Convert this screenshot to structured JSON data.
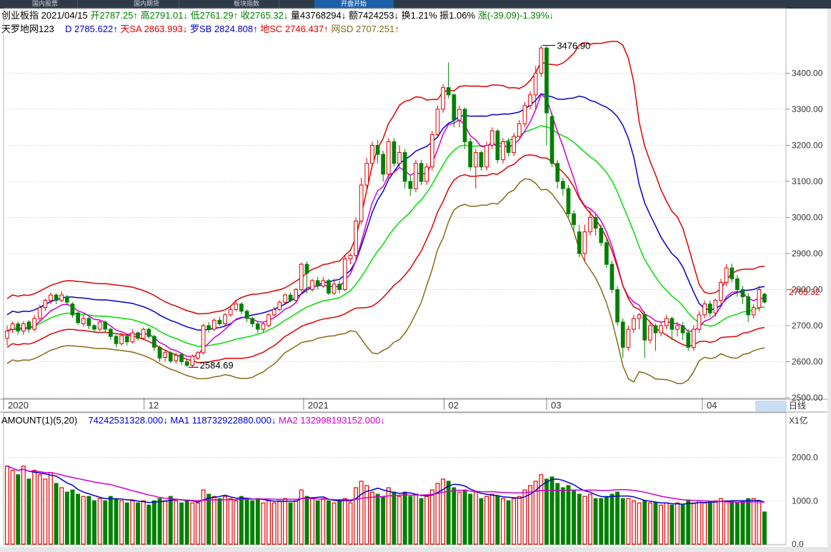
{
  "tabs": [
    "国内股票",
    "国内期货",
    "板块指数",
    "开盘开始",
    ""
  ],
  "header": {
    "name": "创业板指",
    "date": "2021/04/15",
    "open_label": "开",
    "open": "2787.25↑",
    "high_label": "高",
    "high": "2791.01↓",
    "low_label": "低",
    "low": "2761.29↑",
    "close_label": "收",
    "close": "2765.32↓",
    "vol_label": "量",
    "vol": "43768294↓",
    "amt_label": "额",
    "amt": "7424253↓",
    "turn_label": "换",
    "turn": "1.21%",
    "amp_label": "振",
    "amp": "1.06%",
    "chg_label": "涨",
    "chg": "(-39.09)-1.39%↓"
  },
  "indicator": {
    "name": "天罗地网123",
    "d_label": "D",
    "d": "2785.622↑",
    "sa_label": "天SA",
    "sa": "2863.993↓",
    "sb_label": "罗SB",
    "sb": "2824.808↑",
    "sc_label": "地SC",
    "sc": "2746.437↑",
    "sd_label": "网SD",
    "sd": "2707.251↑"
  },
  "amount": {
    "name": "AMOUNT(1)(5,20)",
    "value": "74242531328.000↓",
    "ma1_label": "MA1",
    "ma1": "118732922880.000↓",
    "ma2_label": "MA2",
    "ma2": "132998193152.000↓"
  },
  "price_axis": [
    "3400.00",
    "3300.00",
    "3200.00",
    "3100.00",
    "3000.00",
    "2900.00",
    "2800.00",
    "2700.00",
    "2600.00",
    "2500.00"
  ],
  "amount_axis": [
    "2000.0",
    "1000.0",
    "0.0"
  ],
  "amount_unit": "X1亿",
  "last_price_label": "2765.32",
  "time_axis": [
    "2020",
    "12",
    "2021",
    "02",
    "03",
    "04"
  ],
  "annotations": {
    "high": "3476.90",
    "low": "2584.69"
  },
  "day_button": "日线",
  "colors": {
    "up": "#e00000",
    "down": "#008000",
    "d": "#0000cc",
    "sa": "#e00000",
    "sb": "#0000cc",
    "sc": "#e00000",
    "sd": "#8b6914",
    "mid": "#00e000",
    "mag": "#d000d0"
  },
  "chart_data": {
    "type": "candlestick",
    "candles": [
      [
        2665,
        2685,
        2700,
        2645,
        1800
      ],
      [
        2690,
        2705,
        2712,
        2680,
        1700
      ],
      [
        2705,
        2685,
        2712,
        2675,
        1600
      ],
      [
        2685,
        2705,
        2712,
        2675,
        1800
      ],
      [
        2710,
        2690,
        2715,
        2680,
        1500
      ],
      [
        2690,
        2720,
        2730,
        2685,
        1700
      ],
      [
        2720,
        2750,
        2758,
        2712,
        1600
      ],
      [
        2750,
        2770,
        2775,
        2740,
        1500
      ],
      [
        2770,
        2785,
        2792,
        2760,
        1650
      ],
      [
        2785,
        2770,
        2790,
        2760,
        1400
      ],
      [
        2770,
        2785,
        2795,
        2765,
        1300
      ],
      [
        2780,
        2765,
        2785,
        2755,
        1200
      ],
      [
        2760,
        2730,
        2765,
        2722,
        1250
      ],
      [
        2735,
        2708,
        2738,
        2702,
        1150
      ],
      [
        2705,
        2720,
        2730,
        2698,
        1100
      ],
      [
        2720,
        2700,
        2725,
        2690,
        1100
      ],
      [
        2700,
        2690,
        2705,
        2680,
        1000
      ],
      [
        2690,
        2710,
        2715,
        2685,
        1050
      ],
      [
        2710,
        2690,
        2715,
        2680,
        1000
      ],
      [
        2690,
        2670,
        2695,
        2660,
        1100
      ],
      [
        2670,
        2650,
        2675,
        2640,
        1050
      ],
      [
        2650,
        2672,
        2680,
        2645,
        1000
      ],
      [
        2670,
        2655,
        2675,
        2645,
        950
      ],
      [
        2655,
        2680,
        2690,
        2650,
        1000
      ],
      [
        2680,
        2665,
        2685,
        2658,
        950
      ],
      [
        2665,
        2690,
        2695,
        2660,
        1000
      ],
      [
        2690,
        2670,
        2695,
        2665,
        900
      ],
      [
        2670,
        2640,
        2675,
        2630,
        1000
      ],
      [
        2640,
        2610,
        2645,
        2600,
        1050
      ],
      [
        2612,
        2625,
        2632,
        2600,
        1000
      ],
      [
        2625,
        2602,
        2630,
        2596,
        1100
      ],
      [
        2603,
        2618,
        2625,
        2595,
        1000
      ],
      [
        2620,
        2600,
        2625,
        2590,
        950
      ],
      [
        2600,
        2590,
        2605,
        2584.69,
        1000
      ],
      [
        2590,
        2615,
        2620,
        2585,
        950
      ],
      [
        2610,
        2625,
        2630,
        2605,
        950
      ],
      [
        2625,
        2700,
        2705,
        2620,
        1250
      ],
      [
        2700,
        2690,
        2710,
        2680,
        1150
      ],
      [
        2690,
        2715,
        2720,
        2685,
        1100
      ],
      [
        2715,
        2705,
        2725,
        2700,
        1050
      ],
      [
        2705,
        2730,
        2735,
        2700,
        1100
      ],
      [
        2730,
        2745,
        2752,
        2725,
        1050
      ],
      [
        2745,
        2760,
        2768,
        2740,
        1000
      ],
      [
        2760,
        2740,
        2765,
        2730,
        1100
      ],
      [
        2740,
        2720,
        2745,
        2710,
        1050
      ],
      [
        2720,
        2705,
        2725,
        2695,
        1000
      ],
      [
        2705,
        2690,
        2712,
        2680,
        1050
      ],
      [
        2690,
        2705,
        2710,
        2682,
        950
      ],
      [
        2700,
        2730,
        2735,
        2695,
        1000
      ],
      [
        2730,
        2745,
        2752,
        2725,
        950
      ],
      [
        2745,
        2765,
        2770,
        2740,
        1000
      ],
      [
        2765,
        2785,
        2790,
        2760,
        1050
      ],
      [
        2785,
        2770,
        2792,
        2765,
        950
      ],
      [
        2770,
        2800,
        2805,
        2765,
        1000
      ],
      [
        2800,
        2870,
        2875,
        2795,
        1250
      ],
      [
        2870,
        2845,
        2878,
        2790,
        1100
      ],
      [
        2800,
        2825,
        2830,
        2795,
        1050
      ],
      [
        2825,
        2810,
        2835,
        2800,
        1000
      ],
      [
        2810,
        2825,
        2835,
        2805,
        1050
      ],
      [
        2825,
        2790,
        2830,
        2785,
        1000
      ],
      [
        2790,
        2815,
        2830,
        2785,
        950
      ],
      [
        2815,
        2800,
        2825,
        2790,
        1000
      ],
      [
        2800,
        2885,
        2895,
        2795,
        1050
      ],
      [
        2885,
        2895,
        2900,
        2870,
        950
      ],
      [
        2895,
        2990,
        3000,
        2880,
        1300
      ],
      [
        2990,
        3090,
        3110,
        2980,
        1450
      ],
      [
        3090,
        3150,
        3165,
        3080,
        1350
      ],
      [
        3150,
        3200,
        3210,
        3140,
        1200
      ],
      [
        3200,
        3175,
        3215,
        3150,
        1150
      ],
      [
        3175,
        3120,
        3185,
        3100,
        1100
      ],
      [
        3120,
        3210,
        3220,
        3110,
        1300
      ],
      [
        3210,
        3150,
        3220,
        3140,
        1200
      ],
      [
        3150,
        3180,
        3200,
        3140,
        1100
      ],
      [
        3180,
        3100,
        3190,
        3080,
        1200
      ],
      [
        3100,
        3080,
        3115,
        3060,
        1100
      ],
      [
        3080,
        3150,
        3160,
        3070,
        1150
      ],
      [
        3150,
        3100,
        3160,
        3090,
        1050
      ],
      [
        3100,
        3140,
        3150,
        3090,
        1100
      ],
      [
        3140,
        3230,
        3240,
        3130,
        1250
      ],
      [
        3230,
        3300,
        3310,
        3220,
        1400
      ],
      [
        3300,
        3360,
        3370,
        3290,
        1500
      ],
      [
        3360,
        3340,
        3430,
        3330,
        1450
      ],
      [
        3340,
        3270,
        3345,
        3250,
        1300
      ],
      [
        3270,
        3300,
        3310,
        3250,
        1200
      ],
      [
        3300,
        3210,
        3305,
        3190,
        1250
      ],
      [
        3210,
        3140,
        3220,
        3130,
        1150
      ],
      [
        3140,
        3180,
        3190,
        3080,
        1200
      ],
      [
        3180,
        3140,
        3185,
        3130,
        1050
      ],
      [
        3140,
        3200,
        3210,
        3130,
        1100
      ],
      [
        3200,
        3240,
        3250,
        3190,
        1150
      ],
      [
        3240,
        3160,
        3245,
        3150,
        1100
      ],
      [
        3160,
        3210,
        3220,
        3150,
        1050
      ],
      [
        3210,
        3180,
        3220,
        3170,
        1000
      ],
      [
        3180,
        3225,
        3235,
        3170,
        1050
      ],
      [
        3225,
        3260,
        3270,
        3220,
        1100
      ],
      [
        3260,
        3310,
        3320,
        3250,
        1250
      ],
      [
        3310,
        3340,
        3350,
        3300,
        1350
      ],
      [
        3340,
        3400,
        3420,
        3300,
        1450
      ],
      [
        3400,
        3470,
        3476.9,
        3390,
        1600
      ],
      [
        3470,
        3290,
        3475,
        3200,
        1500
      ],
      [
        3280,
        3150,
        3290,
        3140,
        1550
      ],
      [
        3150,
        3100,
        3160,
        3080,
        1400
      ],
      [
        3100,
        3080,
        3110,
        3060,
        1300
      ],
      [
        3080,
        3010,
        3090,
        3000,
        1350
      ],
      [
        3010,
        2980,
        3020,
        2960,
        1250
      ],
      [
        2960,
        2900,
        2980,
        2890,
        1150
      ],
      [
        2900,
        2960,
        2980,
        2880,
        1100
      ],
      [
        2960,
        3000,
        3020,
        2950,
        1150
      ],
      [
        3000,
        2970,
        3010,
        2950,
        1050
      ],
      [
        2970,
        2930,
        2980,
        2920,
        1050
      ],
      [
        2930,
        2870,
        2940,
        2860,
        1100
      ],
      [
        2870,
        2800,
        2880,
        2790,
        1150
      ],
      [
        2800,
        2710,
        2810,
        2700,
        1200
      ],
      [
        2710,
        2640,
        2720,
        2610,
        1050
      ],
      [
        2640,
        2690,
        2700,
        2630,
        1050
      ],
      [
        2690,
        2720,
        2730,
        2680,
        1000
      ],
      [
        2720,
        2730,
        2735,
        2690,
        950
      ],
      [
        2730,
        2660,
        2740,
        2610,
        1000
      ],
      [
        2660,
        2700,
        2710,
        2650,
        950
      ],
      [
        2700,
        2680,
        2705,
        2630,
        950
      ],
      [
        2680,
        2700,
        2710,
        2670,
        900
      ],
      [
        2700,
        2720,
        2730,
        2690,
        950
      ],
      [
        2720,
        2690,
        2725,
        2660,
        900
      ],
      [
        2690,
        2700,
        2710,
        2670,
        950
      ],
      [
        2700,
        2680,
        2710,
        2660,
        900
      ],
      [
        2680,
        2640,
        2690,
        2630,
        1000
      ],
      [
        2640,
        2690,
        2700,
        2630,
        950
      ],
      [
        2690,
        2730,
        2740,
        2680,
        1000
      ],
      [
        2730,
        2760,
        2770,
        2720,
        950
      ],
      [
        2760,
        2735,
        2770,
        2725,
        950
      ],
      [
        2735,
        2770,
        2775,
        2725,
        1000
      ],
      [
        2770,
        2820,
        2830,
        2760,
        1050
      ],
      [
        2820,
        2860,
        2870,
        2810,
        1000
      ],
      [
        2860,
        2830,
        2872,
        2820,
        1000
      ],
      [
        2830,
        2800,
        2840,
        2780,
        950
      ],
      [
        2800,
        2780,
        2810,
        2760,
        1000
      ],
      [
        2780,
        2730,
        2790,
        2710,
        1050
      ],
      [
        2730,
        2750,
        2760,
        2720,
        1050
      ],
      [
        2750,
        2800,
        2810,
        2740,
        1000
      ],
      [
        2787.25,
        2765.32,
        2791.01,
        2761.29,
        742
      ]
    ],
    "ylim": [
      2500,
      3500
    ],
    "amount_ylim": [
      0,
      2700
    ]
  }
}
